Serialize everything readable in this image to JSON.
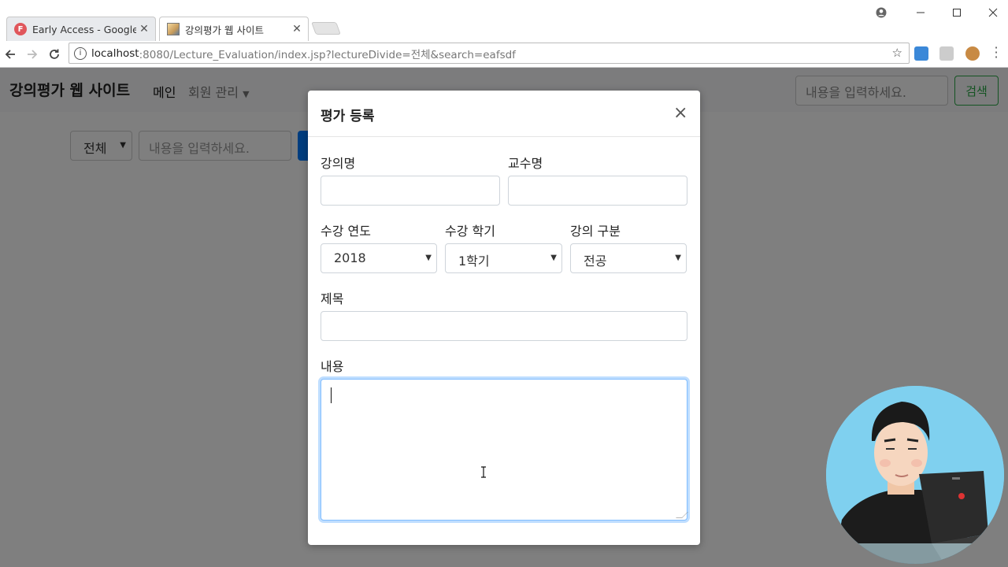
{
  "browser": {
    "tabs": [
      {
        "label": "Early Access - Google F",
        "active": false,
        "favicon": "f-letter-icon"
      },
      {
        "label": "강의평가 웹 사이트",
        "active": true,
        "favicon": "image-icon"
      }
    ],
    "url_host": "localhost",
    "url_rest": ":8080/Lecture_Evaluation/index.jsp?lectureDivide=전체&search=eafsdf"
  },
  "navbar": {
    "brand": "강의평가 웹 사이트",
    "main": "메인",
    "member": "회원 관리",
    "search_placeholder": "내용을 입력하세요.",
    "search_button": "검색"
  },
  "filter": {
    "divide": "전체",
    "search_placeholder": "내용을 입력하세요."
  },
  "modal": {
    "title": "평가 등록",
    "close": "×",
    "lecture_name_label": "강의명",
    "professor_label": "교수명",
    "year_label": "수강 연도",
    "year_value": "2018",
    "semester_label": "수강 학기",
    "semester_value": "1학기",
    "divide_label": "강의 구분",
    "divide_value": "전공",
    "title_label": "제목",
    "content_label": "내용"
  },
  "colors": {
    "primary": "#007bff",
    "success": "#28a745",
    "overlay": "rgba(0,0,0,0.5)"
  }
}
